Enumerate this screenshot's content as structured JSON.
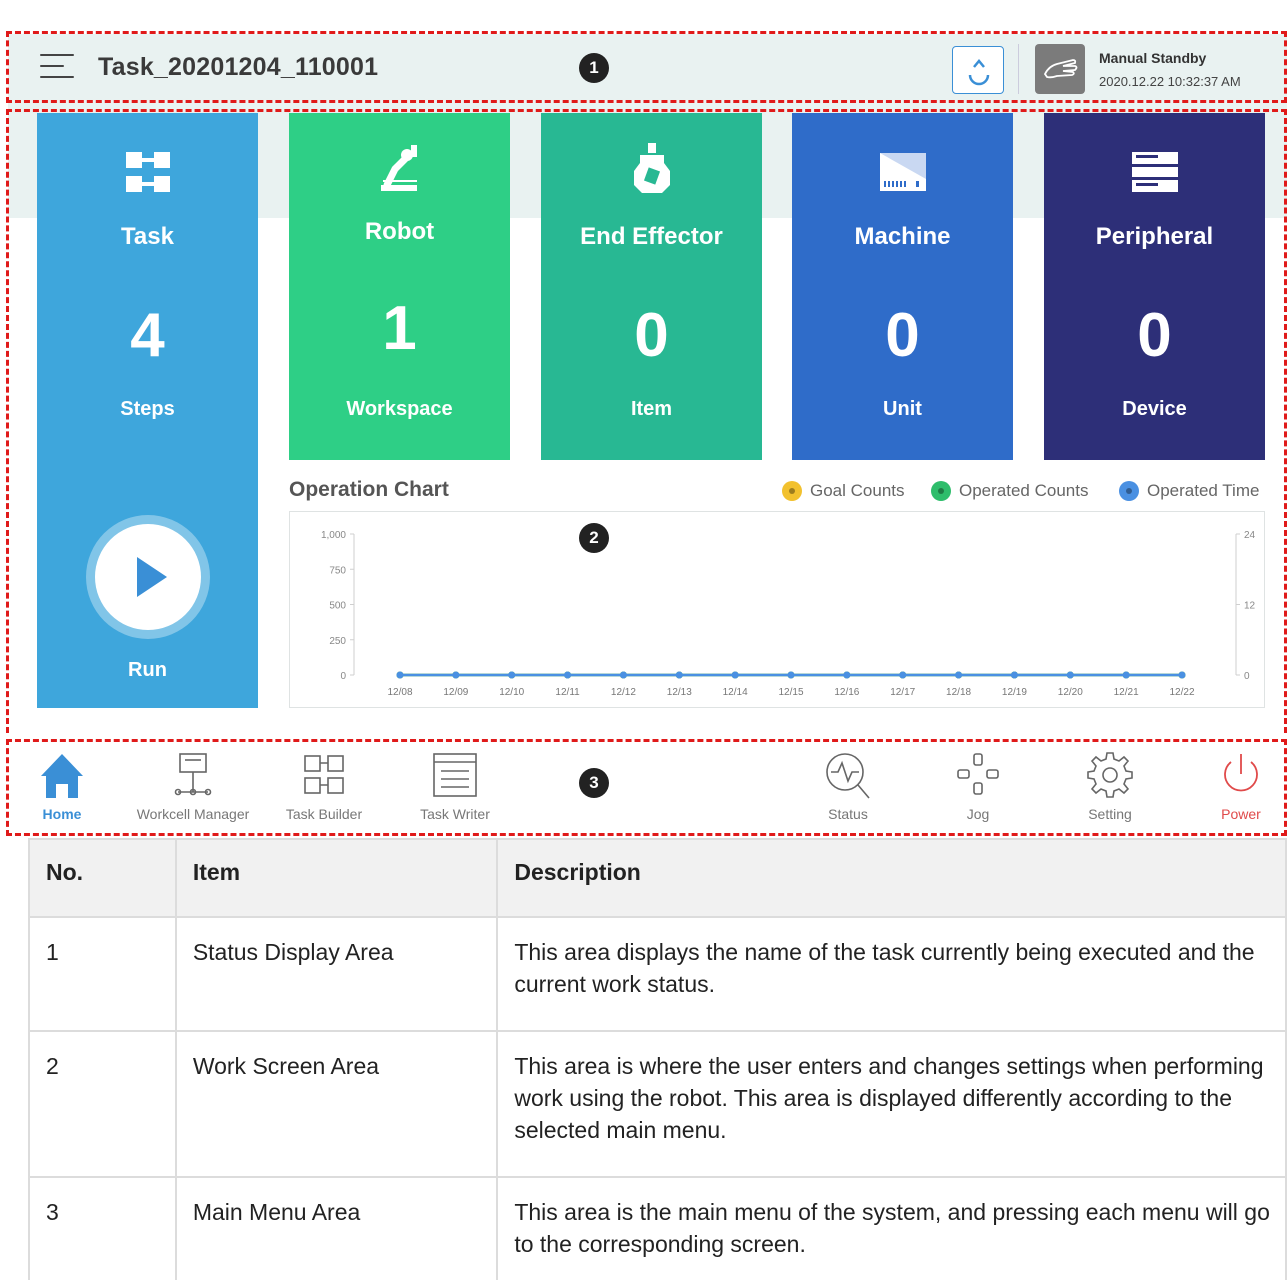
{
  "status_bar": {
    "task_name": "Task_20201204_110001",
    "mode_label": "Manual Standby",
    "datetime": "2020.12.22 10:32:37 AM"
  },
  "markers": [
    "1",
    "2",
    "3"
  ],
  "cards": [
    {
      "title": "Task",
      "count": "4",
      "unit": "Steps",
      "color": "#3ea6dc",
      "icon": "task-icon"
    },
    {
      "title": "Robot",
      "count": "1",
      "unit": "Workspace",
      "color": "#2ecf86",
      "icon": "robot-arm-icon"
    },
    {
      "title": "End Effector",
      "count": "0",
      "unit": "Item",
      "color": "#28b893",
      "icon": "gripper-icon"
    },
    {
      "title": "Machine",
      "count": "0",
      "unit": "Unit",
      "color": "#2f6cc9",
      "icon": "machine-icon"
    },
    {
      "title": "Peripheral",
      "count": "0",
      "unit": "Device",
      "color": "#2d2f78",
      "icon": "peripheral-icon"
    }
  ],
  "run_label": "Run",
  "chart": {
    "title": "Operation Chart",
    "legend": [
      {
        "label": "Goal Counts",
        "color": "#f2c12e"
      },
      {
        "label": "Operated Counts",
        "color": "#2ebd6b"
      },
      {
        "label": "Operated Time",
        "color": "#4a90e2"
      }
    ]
  },
  "chart_data": {
    "type": "line",
    "title": "Operation Chart",
    "categories": [
      "12/08",
      "12/09",
      "12/10",
      "12/11",
      "12/12",
      "12/13",
      "12/14",
      "12/15",
      "12/16",
      "12/17",
      "12/18",
      "12/19",
      "12/20",
      "12/21",
      "12/22"
    ],
    "series": [
      {
        "name": "Goal Counts",
        "axis": "left",
        "values": [
          0,
          0,
          0,
          0,
          0,
          0,
          0,
          0,
          0,
          0,
          0,
          0,
          0,
          0,
          0
        ]
      },
      {
        "name": "Operated Counts",
        "axis": "left",
        "values": [
          0,
          0,
          0,
          0,
          0,
          0,
          0,
          0,
          0,
          0,
          0,
          0,
          0,
          0,
          0
        ]
      },
      {
        "name": "Operated Time",
        "axis": "right",
        "values": [
          0,
          0,
          0,
          0,
          0,
          0,
          0,
          0,
          0,
          0,
          0,
          0,
          0,
          0,
          0
        ]
      }
    ],
    "y_left": {
      "ticks": [
        "1,000",
        "750",
        "500",
        "250",
        "0"
      ],
      "range": [
        0,
        1000
      ]
    },
    "y_right": {
      "ticks": [
        "24",
        "12",
        "0"
      ],
      "range": [
        0,
        24
      ]
    },
    "legend_position": "top-right"
  },
  "nav": [
    {
      "label": "Home",
      "icon": "home-icon",
      "active": true
    },
    {
      "label": "Workcell Manager",
      "icon": "workcell-icon"
    },
    {
      "label": "Task Builder",
      "icon": "task-builder-icon"
    },
    {
      "label": "Task Writer",
      "icon": "task-writer-icon"
    },
    {
      "label": "Status",
      "icon": "status-icon"
    },
    {
      "label": "Jog",
      "icon": "jog-icon"
    },
    {
      "label": "Setting",
      "icon": "gear-icon"
    },
    {
      "label": "Power",
      "icon": "power-icon"
    }
  ],
  "table": {
    "headers": [
      "No.",
      "Item",
      "Description"
    ],
    "rows": [
      {
        "no": "1",
        "item": "Status Display Area",
        "desc": "This area displays the name of the task currently being executed and the current work status."
      },
      {
        "no": "2",
        "item": "Work Screen Area",
        "desc": "This area is where the user enters and changes settings when performing work using the robot. This area is displayed differently according to the selected main menu."
      },
      {
        "no": "3",
        "item": "Main Menu Area",
        "desc": "This area is the main menu of the system, and pressing each menu will go to the corresponding screen."
      }
    ]
  }
}
